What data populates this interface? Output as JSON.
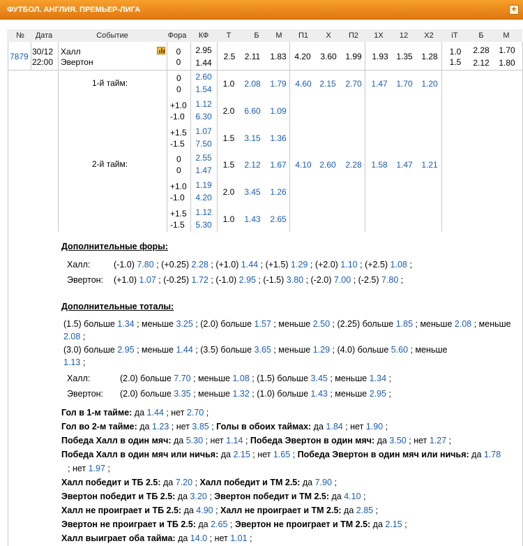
{
  "header": {
    "title": "ФУТБОЛ. АНГЛИЯ. ПРЕМЬЕР-ЛИГА",
    "expand_label": "+"
  },
  "columns": [
    "№",
    "Дата",
    "Событие",
    "Фора",
    "КФ",
    "Т",
    "Б",
    "М",
    "П1",
    "Х",
    "П2",
    "1Х",
    "12",
    "Х2",
    "iТ",
    "Б",
    "М"
  ],
  "match": {
    "number": "7879",
    "date": "30/12",
    "time": "22:00",
    "team1": "Халл",
    "team2": "Эвертон",
    "fora1": "0",
    "fora2": "0",
    "kf1": "2.95",
    "kf2": "1.44",
    "t": "2.5",
    "b": "2.11",
    "m": "1.83",
    "p1": "4.20",
    "x": "3.60",
    "p2": "1.99",
    "x1": "1.93",
    "x12": "1.35",
    "x2": "1.28",
    "it1": "1.0",
    "it2": "1.5",
    "ib1": "2.28",
    "ib2": "2.12",
    "im1": "1.70",
    "im2": "1.80"
  },
  "halves": [
    {
      "label": "1-й тайм:",
      "rows": [
        {
          "f1": "0",
          "f2": "0",
          "k1": "2.60",
          "k2": "1.54",
          "t": "1.0",
          "b": "2.08",
          "m": "1.79",
          "p1": "4.60",
          "x": "2.15",
          "p2": "2.70",
          "x1": "1.47",
          "x12": "1.70",
          "x2": "1.20"
        },
        {
          "f1": "+1.0",
          "f2": "-1.0",
          "k1": "1.12",
          "k2": "6.30",
          "t": "2.0",
          "b": "6.60",
          "m": "1.09"
        },
        {
          "f1": "+1.5",
          "f2": "-1.5",
          "k1": "1.07",
          "k2": "7.50",
          "t": "1.5",
          "b": "3.15",
          "m": "1.36"
        }
      ]
    },
    {
      "label": "2-й тайм:",
      "rows": [
        {
          "f1": "0",
          "f2": "0",
          "k1": "2.55",
          "k2": "1.47",
          "t": "1.5",
          "b": "2.12",
          "m": "1.67",
          "p1": "4.10",
          "x": "2.60",
          "p2": "2.28",
          "x1": "1.58",
          "x12": "1.47",
          "x2": "1.21"
        },
        {
          "f1": "+1.0",
          "f2": "-1.0",
          "k1": "1.19",
          "k2": "4.20",
          "t": "2.0",
          "b": "3.45",
          "m": "1.26"
        },
        {
          "f1": "+1.5",
          "f2": "-1.5",
          "k1": "1.12",
          "k2": "5.30",
          "t": "1.0",
          "b": "1.43",
          "m": "2.65"
        }
      ]
    }
  ],
  "extra_handicaps": {
    "title": "Дополнительные форы:",
    "rows": [
      {
        "team": "Халл:",
        "items": [
          [
            "(-1.0)",
            "7.80"
          ],
          [
            "(+0.25)",
            "2.28"
          ],
          [
            "(+1.0)",
            "1.44"
          ],
          [
            "(+1.5)",
            "1.29"
          ],
          [
            "(+2.0)",
            "1.10"
          ],
          [
            "(+2.5)",
            "1.08"
          ]
        ]
      },
      {
        "team": "Эвертон:",
        "items": [
          [
            "(+1.0)",
            "1.07"
          ],
          [
            "(-0.25)",
            "1.72"
          ],
          [
            "(-1.0)",
            "2.95"
          ],
          [
            "(-1.5)",
            "3.80"
          ],
          [
            "(-2.0)",
            "7.00"
          ],
          [
            "(-2.5)",
            "7.80"
          ]
        ]
      }
    ]
  },
  "extra_totals": {
    "title": "Дополнительные тоталы:",
    "more": "больше",
    "less": "меньше",
    "general": [
      [
        "(1.5)",
        "1.34",
        "3.25"
      ],
      [
        "(2.0)",
        "1.57",
        "2.50"
      ],
      [
        "(2.25)",
        "1.85",
        "2.08"
      ],
      [
        "(3.0)",
        "2.95",
        "1.44"
      ],
      [
        "(3.5)",
        "3.65",
        "1.29"
      ],
      [
        "(4.0)",
        "5.60",
        "1.13"
      ]
    ],
    "hull_label": "Халл:",
    "hull": [
      [
        "(2.0)",
        "7.70",
        "1.08"
      ],
      [
        "(1.5)",
        "3.45",
        "1.34"
      ]
    ],
    "everton_label": "Эвертон:",
    "everton": [
      [
        "(2.0)",
        "3.35",
        "1.32"
      ],
      [
        "(1.0)",
        "1.43",
        "2.95"
      ]
    ]
  },
  "specials": [
    [
      [
        "Гол в 1-м тайме:",
        ""
      ],
      [
        "да",
        "1.44"
      ],
      [
        "нет",
        "2.70"
      ]
    ],
    [
      [
        "Гол во 2-м тайме:",
        ""
      ],
      [
        "да",
        "1.23"
      ],
      [
        "нет",
        "3.85"
      ],
      [
        "Голы в обоих таймах:",
        ""
      ],
      [
        "да",
        "1.84"
      ],
      [
        "нет",
        "1.90"
      ]
    ],
    [
      [
        "Победа Халл в один мяч:",
        ""
      ],
      [
        "да",
        "5.30"
      ],
      [
        "нет",
        "1.14"
      ],
      [
        "Победа Эвертон в один мяч:",
        ""
      ],
      [
        "да",
        "3.50"
      ],
      [
        "нет",
        "1.27"
      ]
    ],
    [
      [
        "Победа Халл в один мяч или ничья:",
        ""
      ],
      [
        "да",
        "2.15"
      ],
      [
        "нет",
        "1.65"
      ],
      [
        "Победа Эвертон в один мяч или ничья:",
        ""
      ],
      [
        "да",
        "1.78"
      ],
      [
        "нет",
        "1.97"
      ]
    ],
    [
      [
        "Халл победит и ТБ 2.5:",
        ""
      ],
      [
        "да",
        "7.20"
      ],
      [
        "Халл победит и ТМ 2.5:",
        ""
      ],
      [
        "да",
        "7.90"
      ]
    ],
    [
      [
        "Эвертон победит и ТБ 2.5:",
        ""
      ],
      [
        "да",
        "3.20"
      ],
      [
        "Эвертон победит и ТМ 2.5:",
        ""
      ],
      [
        "да",
        "4.10"
      ]
    ],
    [
      [
        "Халл не проиграет и ТБ 2.5:",
        ""
      ],
      [
        "да",
        "4.90"
      ],
      [
        "Халл не проиграет и ТМ 2.5:",
        ""
      ],
      [
        "да",
        "2.85"
      ]
    ],
    [
      [
        "Эвертон не проиграет и ТБ 2.5:",
        ""
      ],
      [
        "да",
        "2.65"
      ],
      [
        "Эвертон не проиграет и ТМ 2.5:",
        ""
      ],
      [
        "да",
        "2.15"
      ]
    ],
    [
      [
        "Халл выиграет оба тайма:",
        ""
      ],
      [
        "да",
        "14.0"
      ],
      [
        "нет",
        "1.01"
      ]
    ]
  ]
}
